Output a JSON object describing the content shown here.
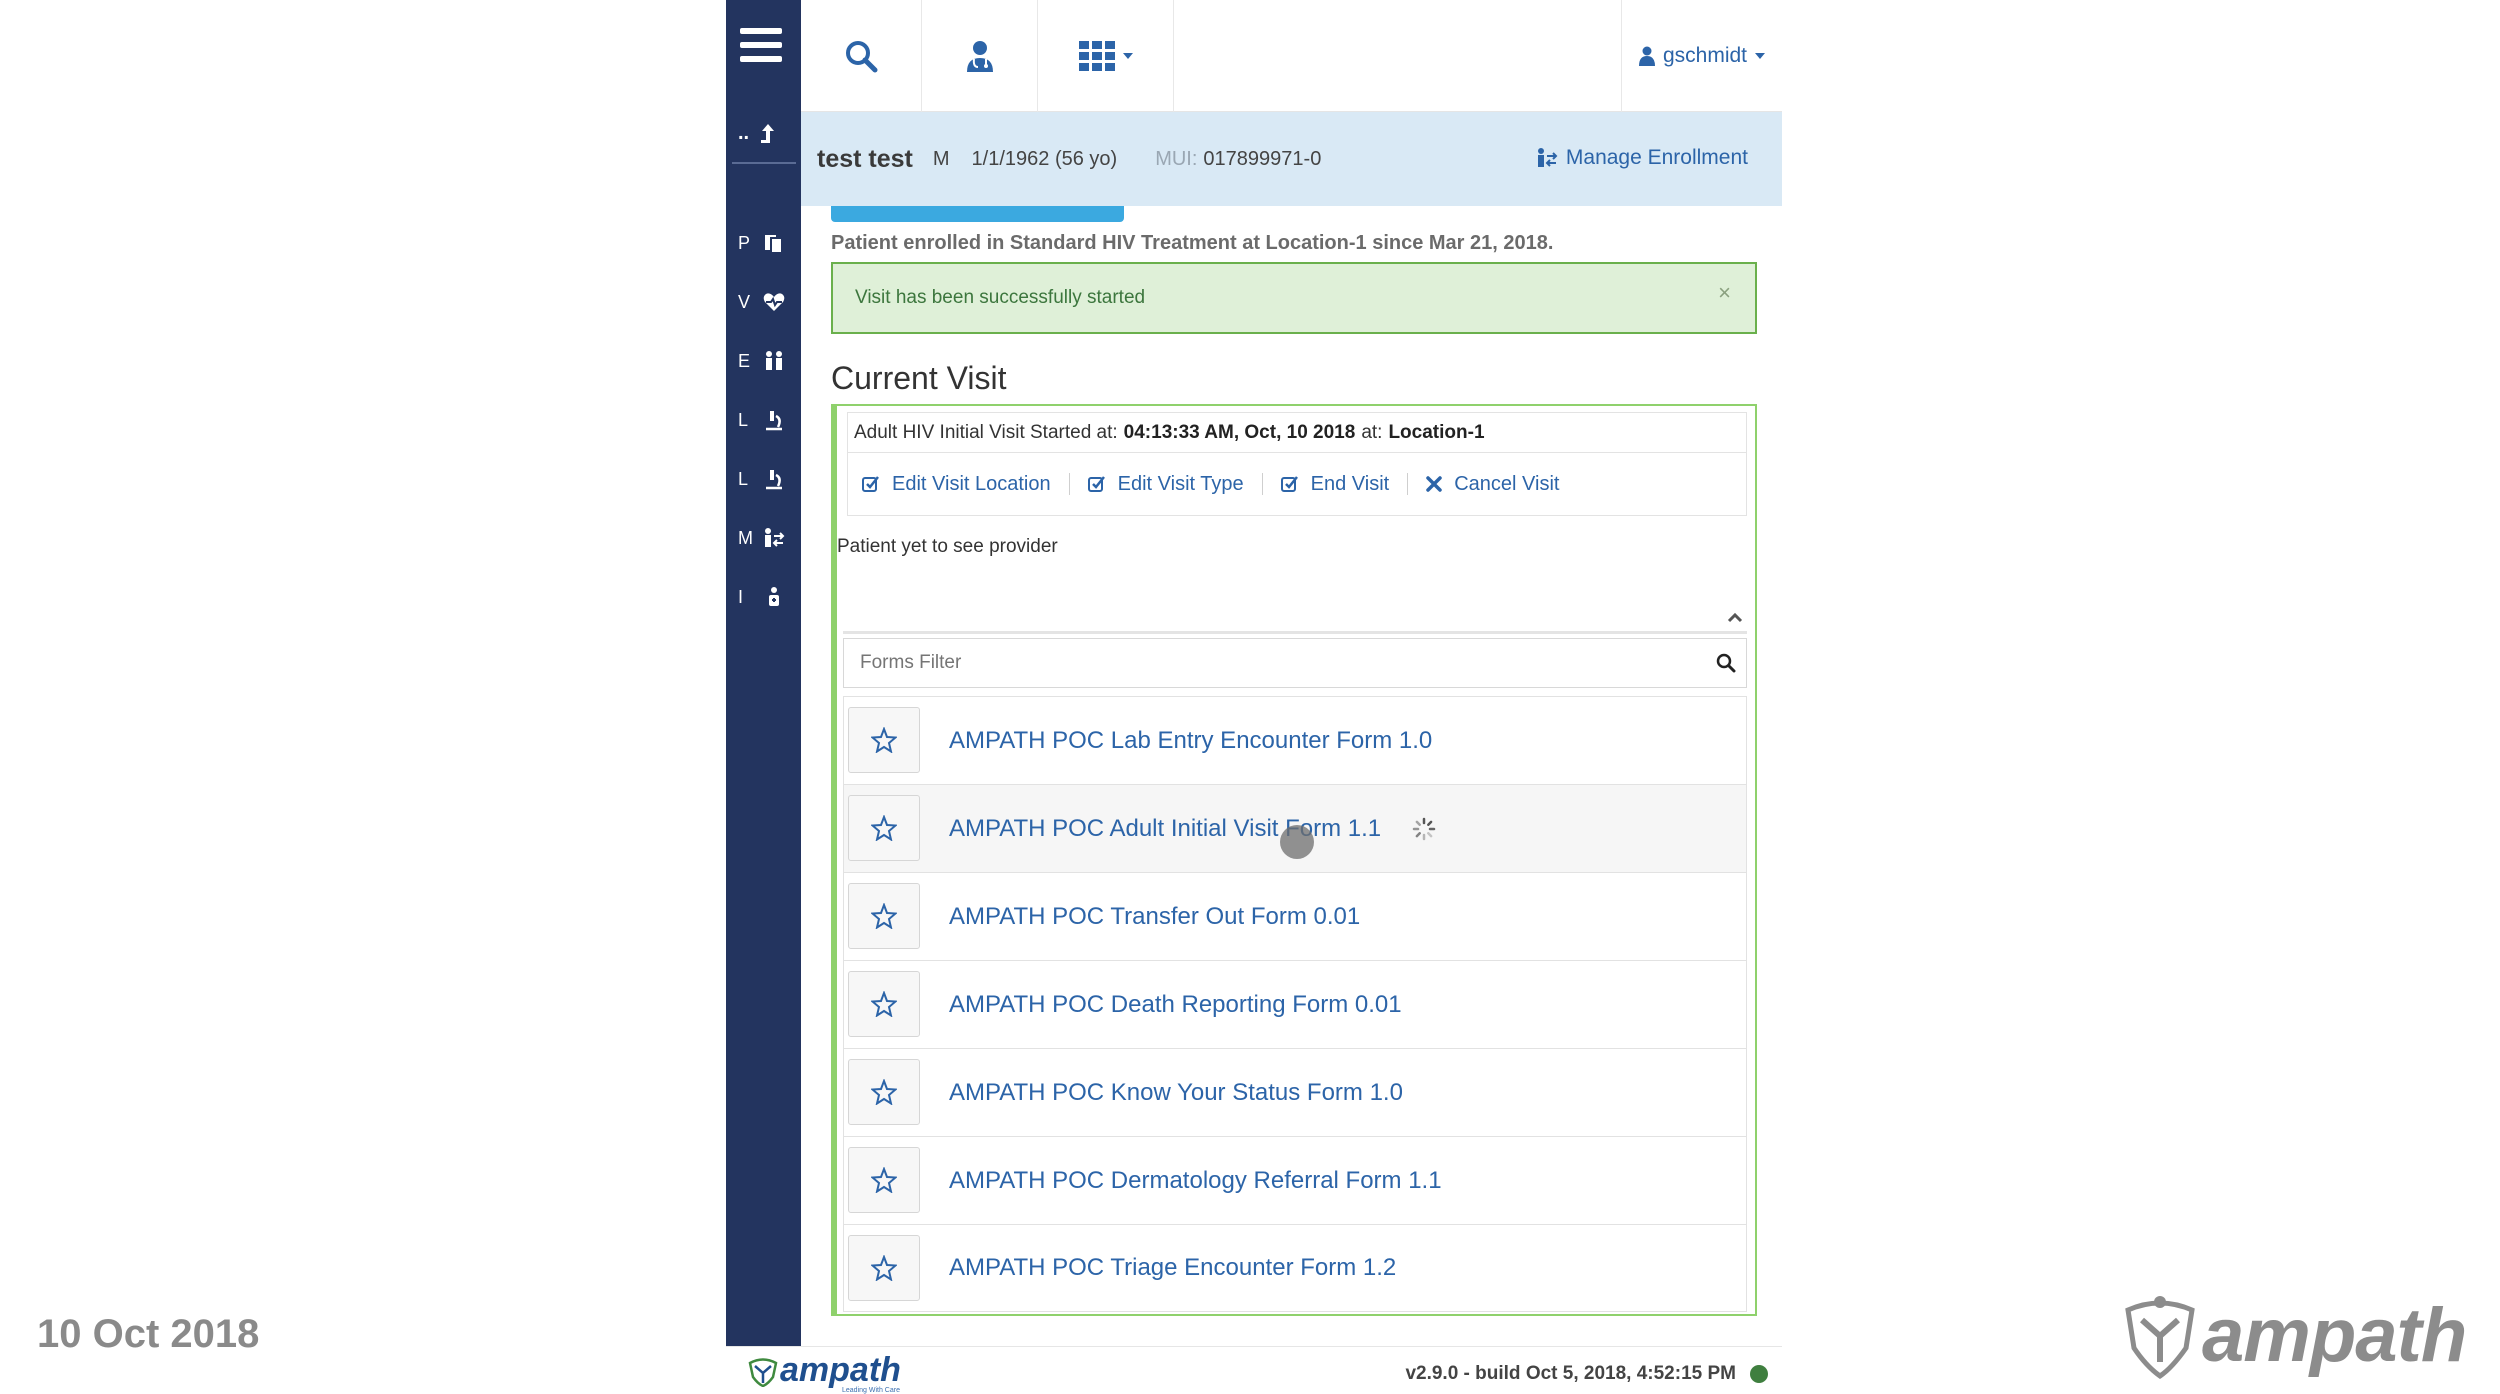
{
  "watermark": {
    "date": "10 Oct 2018",
    "brand": "ampath"
  },
  "sidebar": {
    "up_label": "..",
    "items": [
      {
        "letter": "P",
        "icon": "documents-icon"
      },
      {
        "letter": "V",
        "icon": "heartbeat-icon"
      },
      {
        "letter": "E",
        "icon": "people-icon"
      },
      {
        "letter": "L",
        "icon": "microscope-icon"
      },
      {
        "letter": "L",
        "icon": "microscope-icon"
      },
      {
        "letter": "M",
        "icon": "transfer-icon"
      },
      {
        "letter": "I",
        "icon": "vaccine-icon"
      }
    ]
  },
  "topbar": {
    "icons": [
      "search-icon",
      "doctor-icon",
      "apps-grid-icon"
    ],
    "user": "gschmidt"
  },
  "patient": {
    "name": "test test",
    "sex": "M",
    "dob": "1/1/1962 (56 yo)",
    "mui_label": "MUI:",
    "mui": "017899971-0",
    "manage_enrollment": "Manage Enrollment"
  },
  "main": {
    "enrollment_text": "Patient enrolled in Standard HIV Treatment at Location-1 since Mar 21, 2018.",
    "alert": {
      "text": "Visit has been successfully started",
      "close": "×"
    },
    "current_visit_title": "Current Visit",
    "visit": {
      "prefix": "Adult HIV Initial Visit Started at:",
      "time": "04:13:33 AM, Oct, 10 2018",
      "at_label": "at:",
      "location": "Location-1"
    },
    "actions": [
      {
        "label": "Edit Visit Location",
        "icon": "edit-check-icon"
      },
      {
        "label": "Edit Visit Type",
        "icon": "edit-check-icon"
      },
      {
        "label": "End Visit",
        "icon": "edit-check-icon"
      },
      {
        "label": "Cancel Visit",
        "icon": "cross-icon"
      }
    ],
    "provider_status": "Patient yet to see provider",
    "forms_filter_placeholder": "Forms Filter",
    "forms": [
      "AMPATH POC Lab Entry Encounter Form 1.0",
      "AMPATH POC Adult Initial Visit Form 1.1",
      "AMPATH POC Transfer Out Form 0.01",
      "AMPATH POC Death Reporting Form 0.01",
      "AMPATH POC Know Your Status Form 1.0",
      "AMPATH POC Dermatology Referral Form 1.1",
      "AMPATH POC Triage Encounter Form 1.2"
    ]
  },
  "footer": {
    "logo": "ampath",
    "tagline": "Leading With Care",
    "build": "v2.9.0 - build Oct 5, 2018, 4:52:15 PM",
    "status_color": "#3f7f3f"
  },
  "colors": {
    "sidebar": "#23345f",
    "link": "#2c64a8",
    "accent_green": "#8fd16c",
    "patient_bar": "#d9e9f5"
  }
}
